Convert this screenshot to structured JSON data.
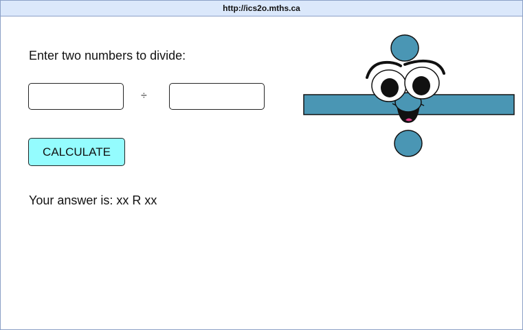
{
  "window": {
    "url": "http://ics2o.mths.ca"
  },
  "main": {
    "prompt": "Enter two numbers to divide:",
    "divide_symbol": "÷",
    "first_number": {
      "value": "",
      "placeholder": ""
    },
    "second_number": {
      "value": "",
      "placeholder": ""
    },
    "calculate_label": "CALCULATE",
    "answer_text": "Your answer is: xx R xx"
  },
  "mascot": {
    "icon": "division-sign-face-icon",
    "bar_color": "#4a96b4",
    "button_color": "#94fcfe"
  }
}
